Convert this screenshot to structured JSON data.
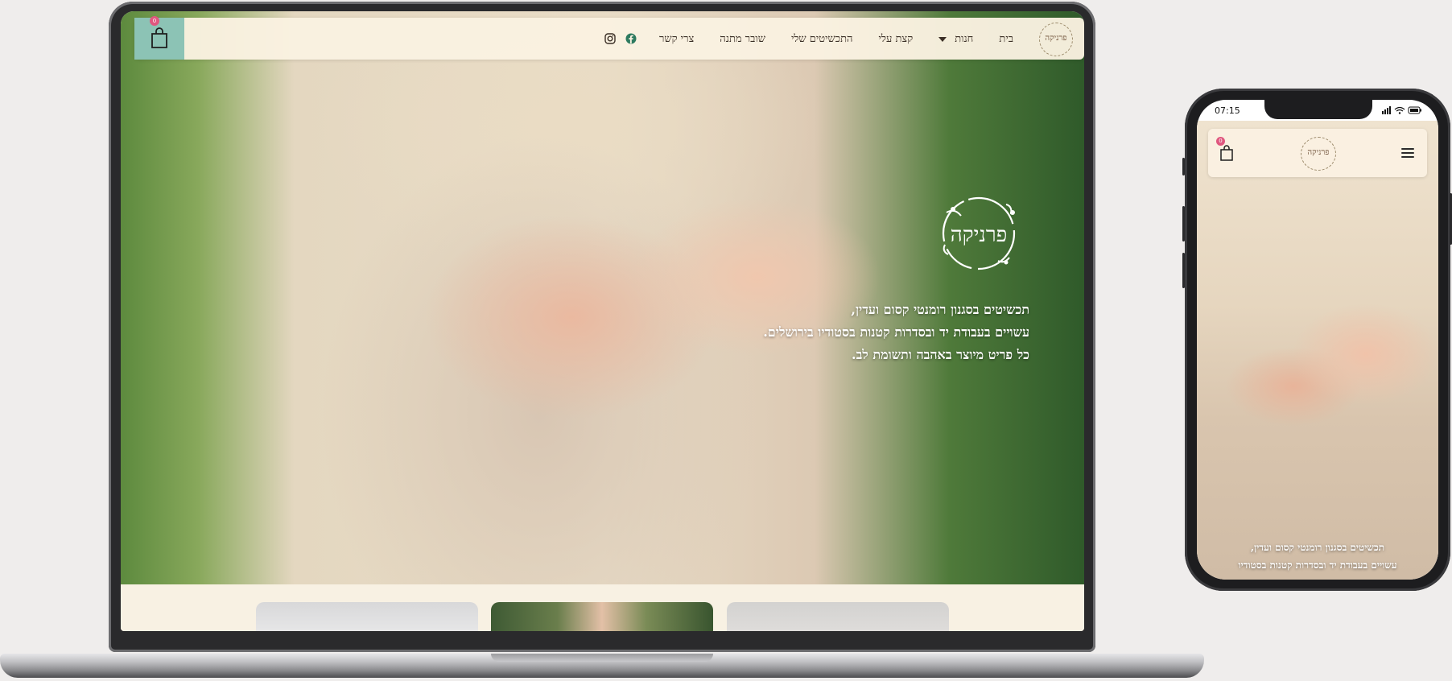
{
  "desktop": {
    "cart": {
      "count": "0"
    },
    "nav": {
      "items": [
        "בית",
        "חנות",
        "קצת עלי",
        "התכשיטים שלי",
        "שובר מתנה",
        "צרי קשר"
      ]
    },
    "logo_text": "פרניקה",
    "hero_lines": [
      "תכשיטים בסגנון רומנטי קסום ועדין,",
      "עשויים בעבודת יד ובסדרות קטנות בסטודיו בירושלים.",
      "כל פריט מיוצר באהבה ותשומת לב."
    ]
  },
  "mobile": {
    "status_time": "07:15",
    "cart": {
      "count": "0"
    },
    "logo_text": "פרניקה",
    "hero_lines": [
      "תכשיטים בסגנון רומנטי קסום ועדין,",
      "עשויים בעבודת יד ובסדרות קטנות בסטודיו"
    ]
  },
  "colors": {
    "cart_accent": "#8cc3b5",
    "badge": "#e0577f",
    "nav_bg": "#faf1e1"
  }
}
